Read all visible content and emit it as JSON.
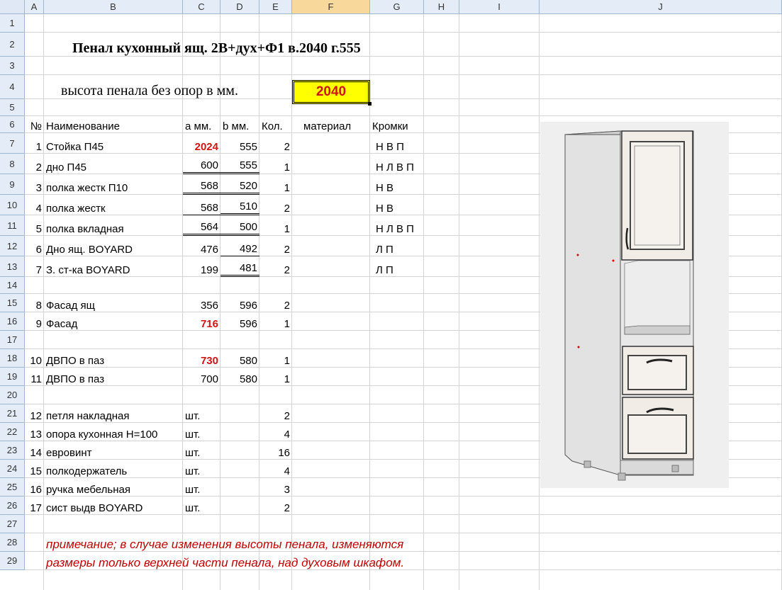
{
  "columns": [
    "A",
    "B",
    "C",
    "D",
    "E",
    "F",
    "G",
    "H",
    "I",
    "J"
  ],
  "rows": [
    "1",
    "2",
    "3",
    "4",
    "5",
    "6",
    "7",
    "8",
    "9",
    "10",
    "11",
    "12",
    "13",
    "14",
    "15",
    "16",
    "17",
    "18",
    "19",
    "20",
    "21",
    "22",
    "23",
    "24",
    "25",
    "26",
    "27",
    "28",
    "29"
  ],
  "title": "Пенал кухонный ящ. 2В+дух+Ф1  в.2040  г.555",
  "height_label": "высота пенала без опор в мм.",
  "height_value": "2040",
  "headers": {
    "no": "№",
    "name": "Наименование",
    "a": "a мм.",
    "b": "b мм.",
    "qty": "Кол.",
    "material": "материал",
    "edges": "Кромки"
  },
  "parts": [
    {
      "no": "1",
      "name": "Стойка П45",
      "a": "2024",
      "b": "555",
      "qty": "2",
      "edges": "Н В П"
    },
    {
      "no": "2",
      "name": "дно П45",
      "a": "600",
      "b": "555",
      "qty": "1",
      "edges": "Н Л В П"
    },
    {
      "no": "3",
      "name": "полка жестк П10",
      "a": "568",
      "b": "520",
      "qty": "1",
      "edges": "Н В"
    },
    {
      "no": "4",
      "name": "полка жестк",
      "a": "568",
      "b": "510",
      "qty": "2",
      "edges": "Н В"
    },
    {
      "no": "5",
      "name": "полка вкладная",
      "a": "564",
      "b": "500",
      "qty": "1",
      "edges": "Н Л В П"
    },
    {
      "no": "6",
      "name": "Дно ящ. BOYARD",
      "a": "476",
      "b": "492",
      "qty": "2",
      "edges": "Л П"
    },
    {
      "no": "7",
      "name": "З. ст-ка  BOYARD",
      "a": "199",
      "b": "481",
      "qty": "2",
      "edges": "Л П"
    }
  ],
  "facades": [
    {
      "no": "8",
      "name": "Фасад ящ",
      "a": "356",
      "b": "596",
      "qty": "2"
    },
    {
      "no": "9",
      "name": "Фасад",
      "a": "716",
      "b": "596",
      "qty": "1"
    }
  ],
  "panels": [
    {
      "no": "10",
      "name": "ДВПО в паз",
      "a": "730",
      "b": "580",
      "qty": "1"
    },
    {
      "no": "11",
      "name": "ДВПО в паз",
      "a": "700",
      "b": "580",
      "qty": "1"
    }
  ],
  "hardware": [
    {
      "no": "12",
      "name": "петля накладная",
      "unit": "шт.",
      "qty": "2"
    },
    {
      "no": "13",
      "name": "опора кухонная Н=100",
      "unit": "шт.",
      "qty": "4"
    },
    {
      "no": "14",
      "name": "евровинт",
      "unit": "шт.",
      "qty": "16"
    },
    {
      "no": "15",
      "name": "полкодержатель",
      "unit": "шт.",
      "qty": "4"
    },
    {
      "no": "16",
      "name": "ручка мебельная",
      "unit": "шт.",
      "qty": "3"
    },
    {
      "no": "17",
      "name": "сист выдв BOYARD",
      "unit": "шт.",
      "qty": "2"
    }
  ],
  "note_line1": "примечание;  в случае изменения высоты пенала, изменяются",
  "note_line2": "размеры только верхней части пенала, над духовым шкафом.",
  "colors": {
    "accent_red": "#d11313",
    "highlight_yellow": "#ffff00",
    "note_red": "#c00000"
  }
}
